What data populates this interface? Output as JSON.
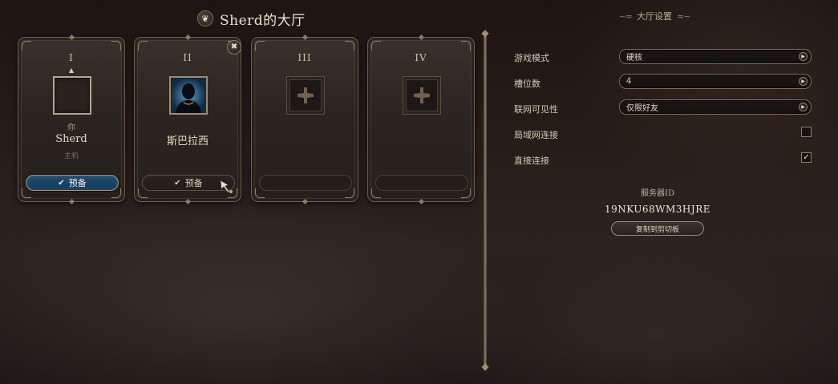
{
  "lobby": {
    "title": "Sherd的大厅",
    "emblem_icon": "feather-icon"
  },
  "players": [
    {
      "numeral": "I",
      "role": "你",
      "name": "Sherd",
      "subtitle": "主机",
      "ready_label": "预备",
      "ready": true,
      "is_host": true
    },
    {
      "numeral": "II",
      "name": "斯巴拉西",
      "ready_label": "预备",
      "ready": true,
      "kickable": true
    },
    {
      "numeral": "III",
      "open": true
    },
    {
      "numeral": "IV",
      "open": true
    }
  ],
  "settings": {
    "title": "大厅设置",
    "game_mode": {
      "label": "游戏模式",
      "value": "硬核"
    },
    "slots": {
      "label": "槽位数",
      "value": "4"
    },
    "online_visibility": {
      "label": "联网可见性",
      "value": "仅限好友"
    },
    "lan": {
      "label": "局域网连接",
      "checked": false
    },
    "direct": {
      "label": "直接连接",
      "checked": true,
      "check_mark": "✓"
    }
  },
  "server": {
    "label": "服务器ID",
    "id": "19NKU68WM3HJRE",
    "copy_label": "复制到剪切板"
  },
  "colors": {
    "ready_active": "#1f4e72",
    "frame": "#6c5d4c",
    "background": "#261c17"
  }
}
